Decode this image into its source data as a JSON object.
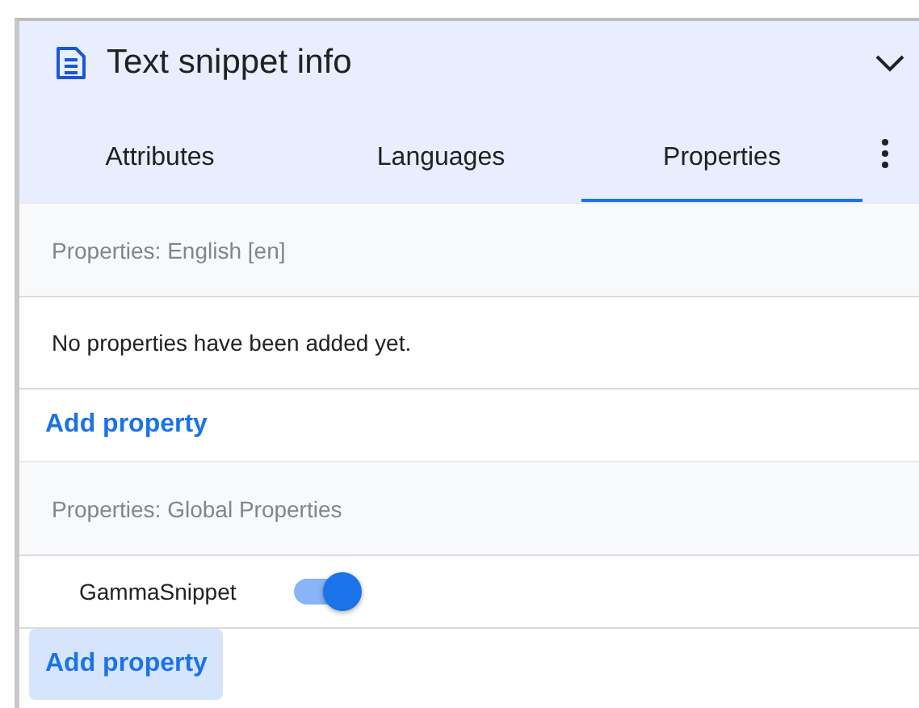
{
  "panel": {
    "title": "Text snippet info",
    "expanded": true
  },
  "tabs": [
    {
      "label": "Attributes",
      "selected": false
    },
    {
      "label": "Languages",
      "selected": false
    },
    {
      "label": "Properties",
      "selected": true
    }
  ],
  "sections": [
    {
      "header": "Properties: English [en]",
      "rows": [
        {
          "kind": "message",
          "text": "No properties have been added yet."
        }
      ],
      "add_button": {
        "label": "Add property",
        "highlighted": false
      }
    },
    {
      "header": "Properties: Global Properties",
      "rows": [
        {
          "kind": "toggle",
          "label": "GammaSnippet",
          "on": true
        }
      ],
      "add_button": {
        "label": "Add property",
        "highlighted": true
      }
    }
  ]
}
